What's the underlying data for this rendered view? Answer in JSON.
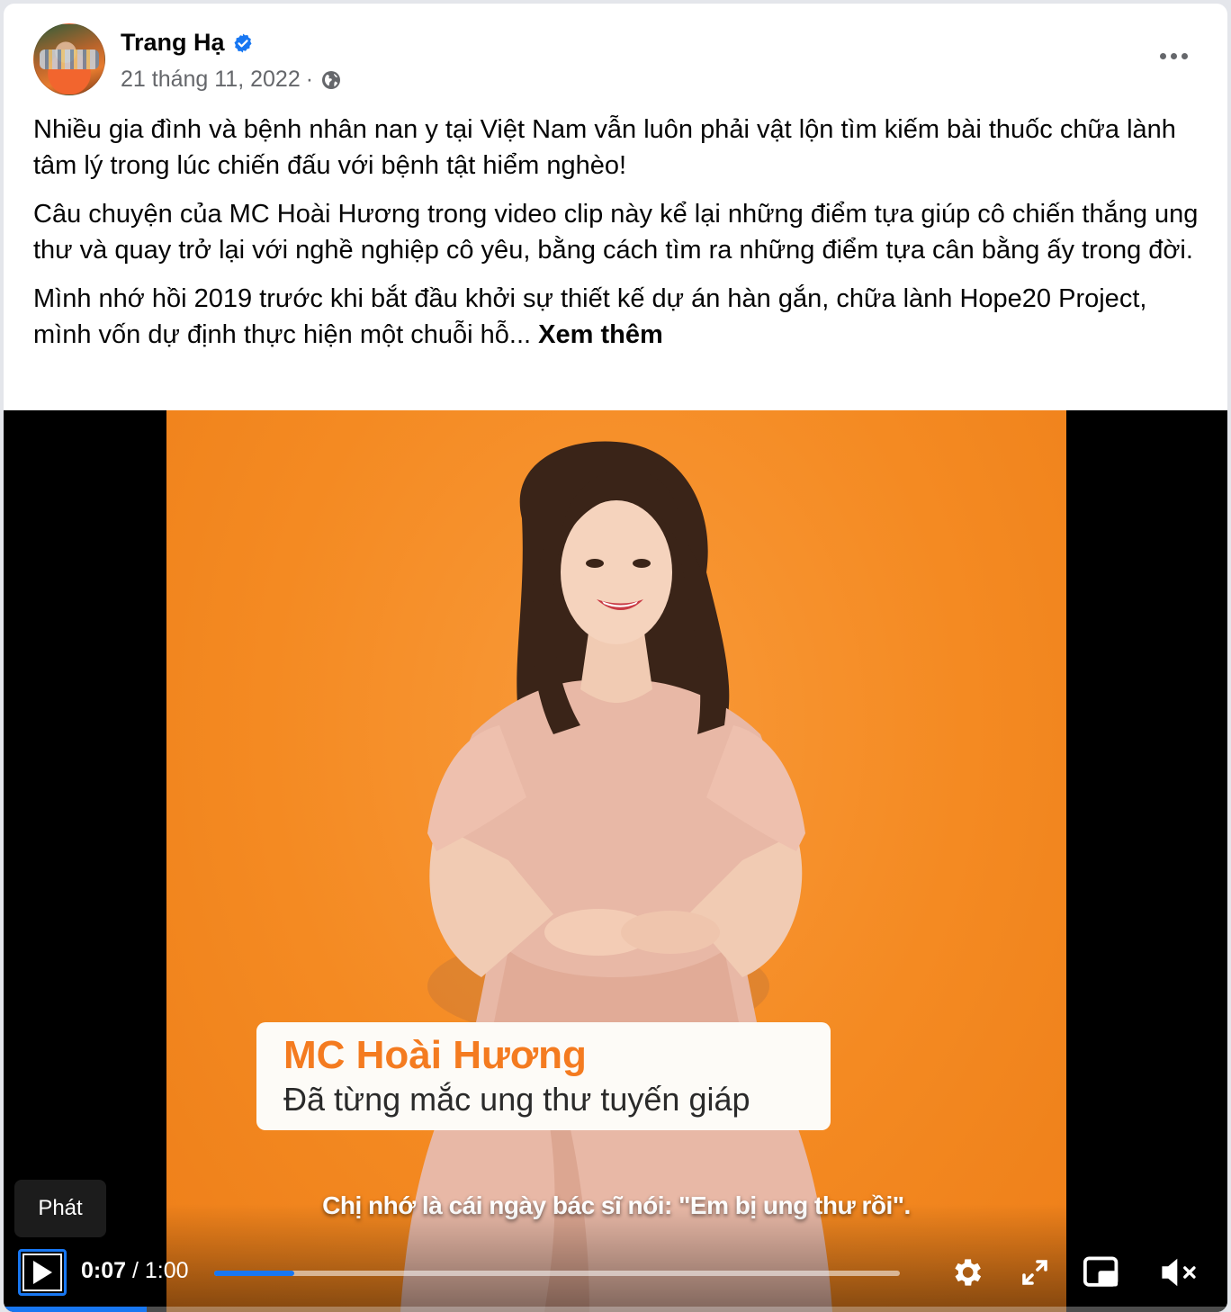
{
  "post": {
    "author": "Trang Hạ",
    "date": "21 tháng 11, 2022",
    "separator": "·",
    "paragraphs": [
      "Nhiều gia đình và bệnh nhân nan y tại Việt Nam vẫn luôn phải vật lộn tìm kiếm bài thuốc chữa lành tâm lý trong lúc chiến đấu với bệnh tật hiểm nghèo!",
      "Câu chuyện của MC Hoài Hương trong video clip này kể lại những điểm tựa giúp cô chiến thắng ung thư và quay trở lại với nghề nghiệp cô yêu, bằng cách tìm ra những điểm tựa cân bằng ấy trong đời.",
      "Mình nhớ hồi 2019 trước khi bắt đầu khởi sự thiết kế dự án hàn gắn, chữa lành Hope20 Project, mình vốn dự định thực hiện một chuỗi hỗ..."
    ],
    "see_more": "Xem thêm",
    "icons": {
      "verified": "verified-badge-icon",
      "privacy": "globe-icon",
      "menu": "more-dots-icon"
    },
    "colors": {
      "verified": "#1877f2",
      "text": "#050505",
      "meta": "#65676b"
    }
  },
  "video": {
    "caption_title": "MC Hoài Hương",
    "caption_subtitle": "Đã từng mắc ung thư tuyến giáp",
    "subtitle": "Chị nhớ là cái ngày bác sĩ nói: \"Em bị ung thư rồi\".",
    "tooltip": "Phát",
    "time_current": "0:07",
    "time_separator": "/",
    "time_total": "1:00",
    "progress": 0.117,
    "controls": [
      "play-icon",
      "settings-gear-icon",
      "fullscreen-icon",
      "picture-in-picture-icon",
      "muted-speaker-icon"
    ],
    "colors": {
      "accent": "#1877f2",
      "background": "#f48a22",
      "caption_title": "#f47b20"
    }
  }
}
